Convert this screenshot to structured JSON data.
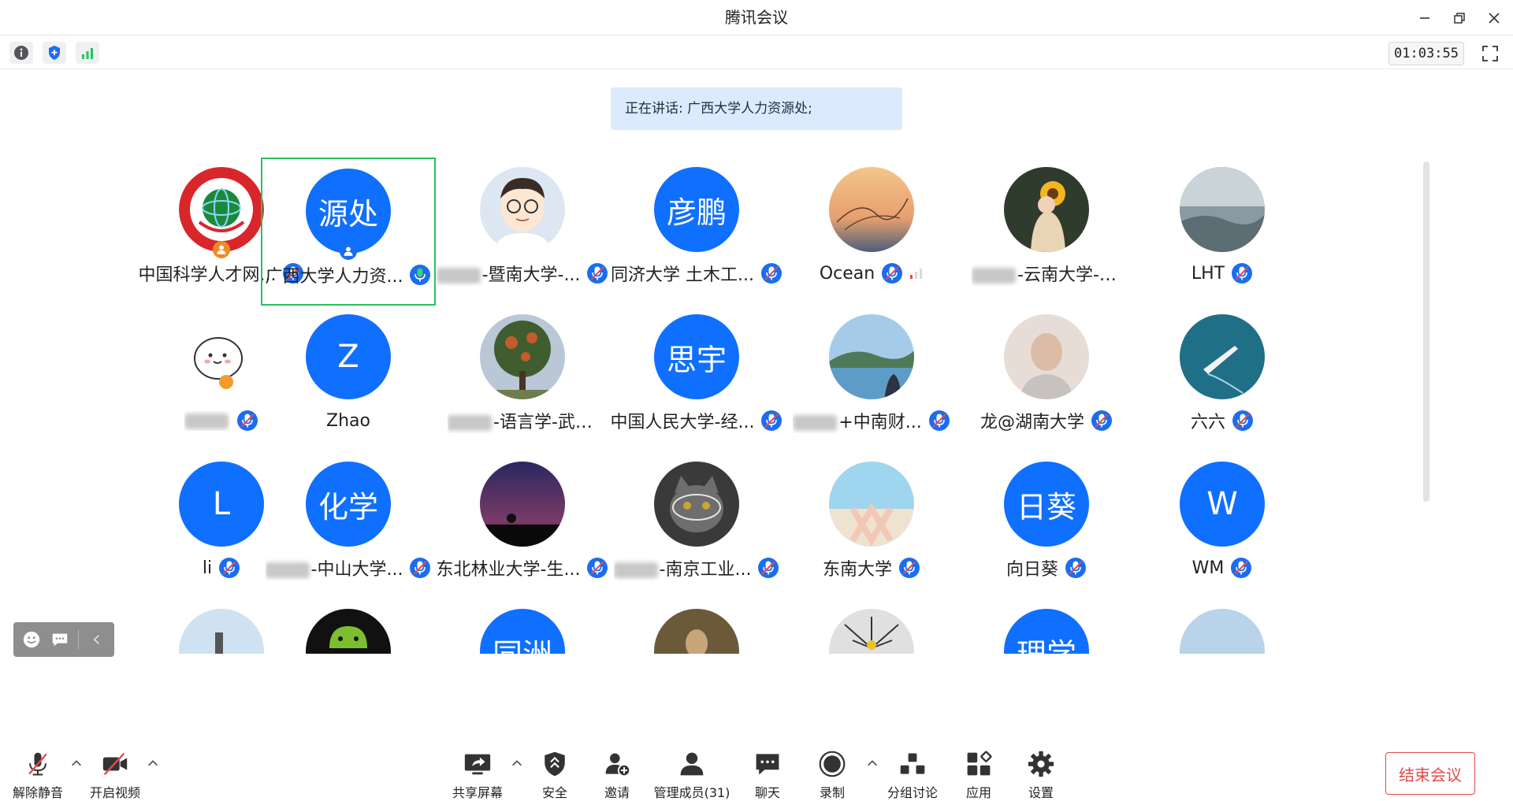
{
  "window": {
    "title": "腾讯会议"
  },
  "infobar": {
    "timer": "01:03:55"
  },
  "speaking": {
    "label": "正在讲话: 广西大学人力资源处;"
  },
  "participants": [
    {
      "name": "中国科学人才网...",
      "avatar_kind": "logo",
      "host": true,
      "mic": "muted"
    },
    {
      "name": "广西大学人力资...",
      "avatar_kind": "text",
      "avatar_text": "源处",
      "host": true,
      "mic": "active",
      "active": true
    },
    {
      "name": "-暨南大学-...",
      "avatar_kind": "cartoon",
      "blurred_prefix": true,
      "mic": "muted"
    },
    {
      "name": "同济大学 土木工...",
      "avatar_kind": "text",
      "avatar_text": "彦鹏",
      "mic": "muted"
    },
    {
      "name": "Ocean",
      "avatar_kind": "photo-sunset",
      "mic": "muted",
      "signal": "weak"
    },
    {
      "name": "-云南大学-物...",
      "avatar_kind": "photo-sunflower",
      "blurred_prefix": true,
      "mic": "none"
    },
    {
      "name": "LHT",
      "avatar_kind": "photo-text",
      "mic": "muted"
    },
    {
      "name": "",
      "avatar_kind": "sticker",
      "blurred_prefix": true,
      "mic": "muted"
    },
    {
      "name": "Zhao",
      "avatar_kind": "text",
      "avatar_text": "Z",
      "mic": "none"
    },
    {
      "name": "-语言学-武汉...",
      "avatar_kind": "photo-tree",
      "blurred_prefix": true,
      "mic": "none"
    },
    {
      "name": "中国人民大学-经...",
      "avatar_kind": "text",
      "avatar_text": "思宇",
      "mic": "muted"
    },
    {
      "name": "+中南财...",
      "avatar_kind": "photo-lake",
      "blurred_prefix": true,
      "mic": "muted"
    },
    {
      "name": "龙@湖南大学",
      "avatar_kind": "photo-person",
      "mic": "muted"
    },
    {
      "name": "六六",
      "avatar_kind": "photo-sea",
      "mic": "muted"
    },
    {
      "name": "li",
      "avatar_kind": "text",
      "avatar_text": "L",
      "mic": "muted"
    },
    {
      "name": "-中山大学...",
      "avatar_kind": "text",
      "avatar_text": "化学",
      "blurred_prefix": true,
      "mic": "muted"
    },
    {
      "name": "东北林业大学-生...",
      "avatar_kind": "photo-night",
      "mic": "muted"
    },
    {
      "name": "-南京工业...",
      "avatar_kind": "photo-cat",
      "blurred_prefix": true,
      "mic": "muted"
    },
    {
      "name": "东南大学",
      "avatar_kind": "photo-beach",
      "mic": "muted"
    },
    {
      "name": "向日葵",
      "avatar_kind": "text",
      "avatar_text": "日葵",
      "mic": "muted"
    },
    {
      "name": "WM",
      "avatar_kind": "text",
      "avatar_text": "W",
      "mic": "muted"
    },
    {
      "name": "",
      "avatar_kind": "photo-sky",
      "mic": "none"
    },
    {
      "name": "",
      "avatar_kind": "photo-android",
      "mic": "none"
    },
    {
      "name": "",
      "avatar_kind": "text",
      "avatar_text": "同洲",
      "mic": "none"
    },
    {
      "name": "",
      "avatar_kind": "photo-bird",
      "mic": "none"
    },
    {
      "name": "",
      "avatar_kind": "photo-plant",
      "mic": "none"
    },
    {
      "name": "",
      "avatar_kind": "text",
      "avatar_text": "理学",
      "mic": "none"
    },
    {
      "name": "",
      "avatar_kind": "photo-sky2",
      "mic": "none"
    }
  ],
  "toolbar": {
    "unmute": "解除静音",
    "video": "开启视频",
    "share": "共享屏幕",
    "security": "安全",
    "invite": "邀请",
    "members": "管理成员(31)",
    "chat": "聊天",
    "record": "录制",
    "breakout": "分组讨论",
    "apps": "应用",
    "settings": "设置",
    "end": "结束会议"
  },
  "colors": {
    "accent": "#0f6fff",
    "active_border": "#27c25f",
    "end_red": "#e24a4a",
    "speaking_bg": "#ddeafd"
  }
}
